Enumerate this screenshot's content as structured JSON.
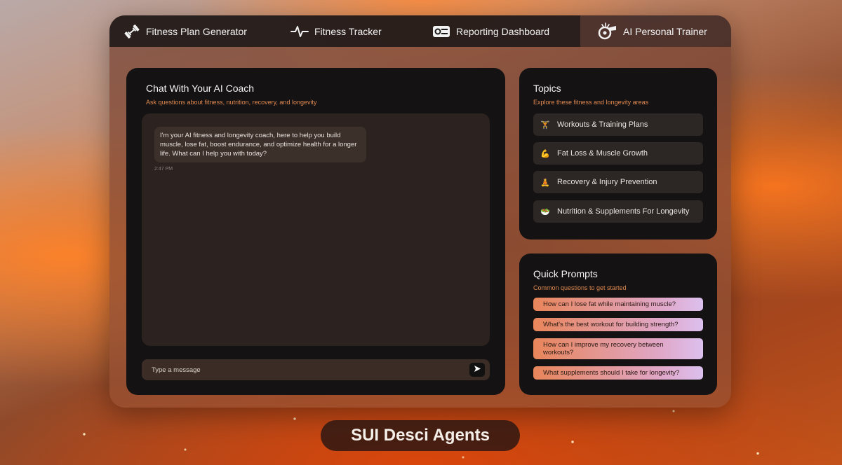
{
  "tabs": [
    {
      "label": "Fitness Plan Generator",
      "icon": "dumbbell-icon"
    },
    {
      "label": "Fitness Tracker",
      "icon": "pulse-icon"
    },
    {
      "label": "Reporting Dashboard",
      "icon": "dashboard-icon"
    },
    {
      "label": "AI Personal Trainer",
      "icon": "whistle-icon",
      "active": true
    }
  ],
  "chat": {
    "title": "Chat With Your AI Coach",
    "subtitle": "Ask questions about fitness, nutrition, recovery, and longevity",
    "messages": [
      {
        "text": "I'm your AI fitness and longevity coach, here to help you build muscle, lose fat, boost endurance, and optimize health for a longer life. What can I help you with today?",
        "time": "2:47 PM"
      }
    ],
    "input_placeholder": "Type a message"
  },
  "topics": {
    "title": "Topics",
    "subtitle": "Explore these fitness and longevity areas",
    "items": [
      {
        "label": "Workouts & Training Plans",
        "icon": "weightlifter-icon",
        "glyph": "🏋"
      },
      {
        "label": "Fat Loss & Muscle Growth",
        "icon": "flexed-arm-icon",
        "glyph": "💪"
      },
      {
        "label": "Recovery & Injury Prevention",
        "icon": "meditation-icon",
        "glyph": "🧘"
      },
      {
        "label": "Nutrition & Supplements For Longevity",
        "icon": "nutrition-icon",
        "glyph": "🥗"
      }
    ]
  },
  "quick_prompts": {
    "title": "Quick Prompts",
    "subtitle": "Common questions to get started",
    "items": [
      "How can I lose fat while maintaining muscle?",
      "What's the best workout for building strength?",
      "How can I improve my recovery between workouts?",
      "What supplements should I take for longevity?"
    ]
  },
  "brand": "SUI Desci Agents",
  "colors": {
    "accent": "#e08a52",
    "card": "#141212",
    "prompt_gradient_start": "#e8855a",
    "prompt_gradient_end": "#dcc0ee"
  }
}
